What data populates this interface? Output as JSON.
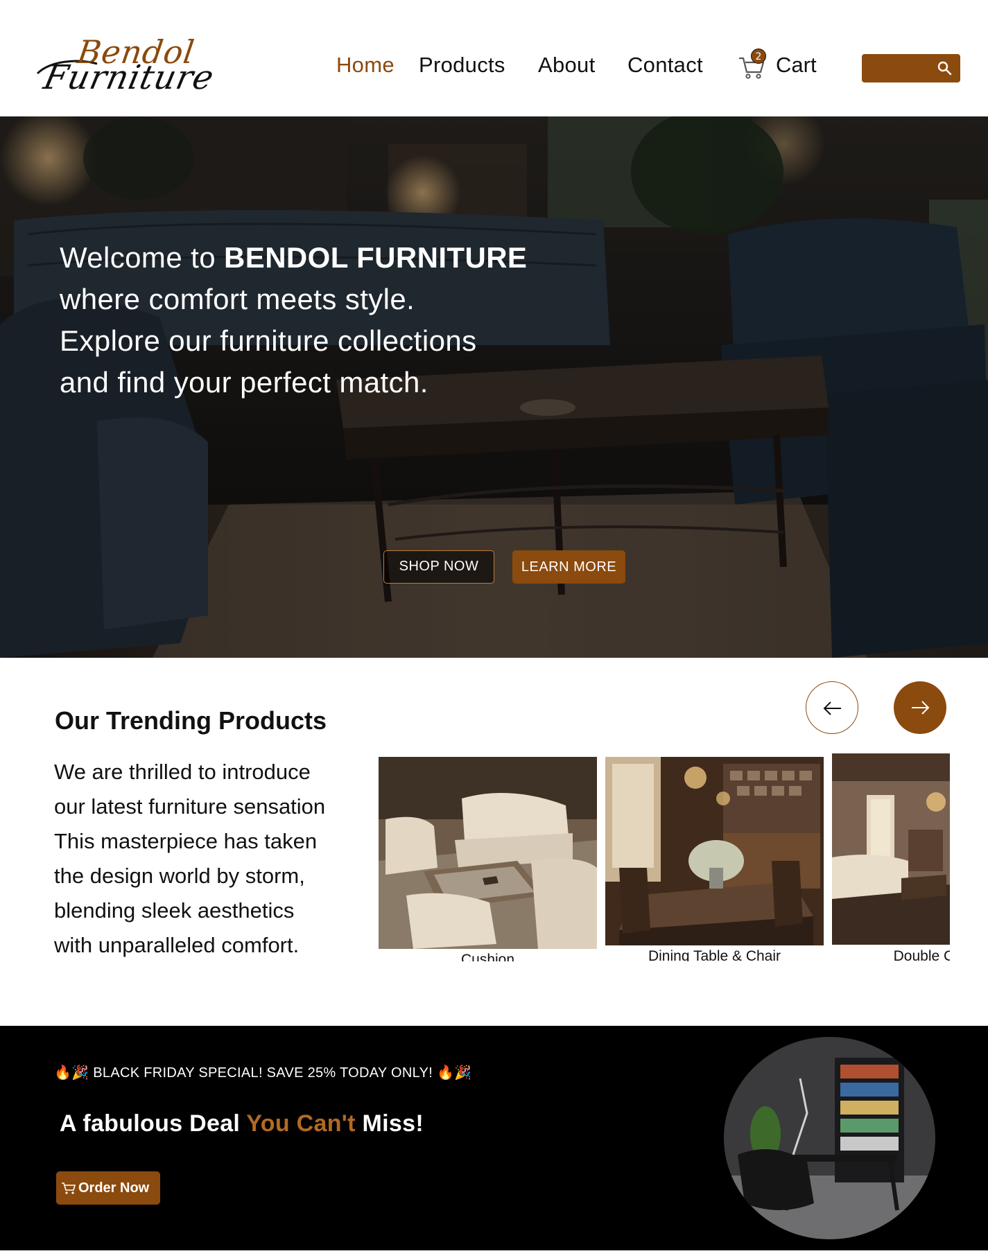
{
  "brand": {
    "logo_line1": "Bendol",
    "logo_line2": "Furniture",
    "accent_color": "#8b4a0e"
  },
  "nav": {
    "items": [
      {
        "label": "Home",
        "active": true
      },
      {
        "label": "Products",
        "active": false
      },
      {
        "label": "About",
        "active": false
      },
      {
        "label": "Contact",
        "active": false
      }
    ],
    "cart_label": "Cart",
    "cart_count": "2",
    "search_icon": "search-icon"
  },
  "hero": {
    "line1_prefix": "Welcome to ",
    "line1_brand": "BENDOL FURNITURE",
    "line2": "where comfort meets style.",
    "line3": "Explore our furniture collections",
    "line4": "and find your perfect match.",
    "shop_now": "SHOP NOW",
    "learn_more": "LEARN MORE"
  },
  "trending": {
    "title": "Our Trending Products",
    "description_lines": [
      "We are thrilled to introduce",
      "our latest furniture sensation",
      "This masterpiece has taken",
      "the design world by storm,",
      "blending sleek aesthetics",
      "with unparalleled comfort."
    ],
    "prev_icon": "arrow-left-icon",
    "next_icon": "arrow-right-icon",
    "products": [
      {
        "caption": "Cushion"
      },
      {
        "caption": "Dining Table & Chair"
      },
      {
        "caption": "Double Cushio"
      }
    ]
  },
  "promo": {
    "top_line": "BLACK FRIDAY SPECIAL! SAVE 25% TODAY ONLY!",
    "emoji_left": "🔥🎉",
    "emoji_right": "🔥🎉",
    "headline_start": "A fabulous Deal ",
    "headline_highlight": "You Can't",
    "headline_end": " Miss!",
    "order_now": "Order Now"
  }
}
